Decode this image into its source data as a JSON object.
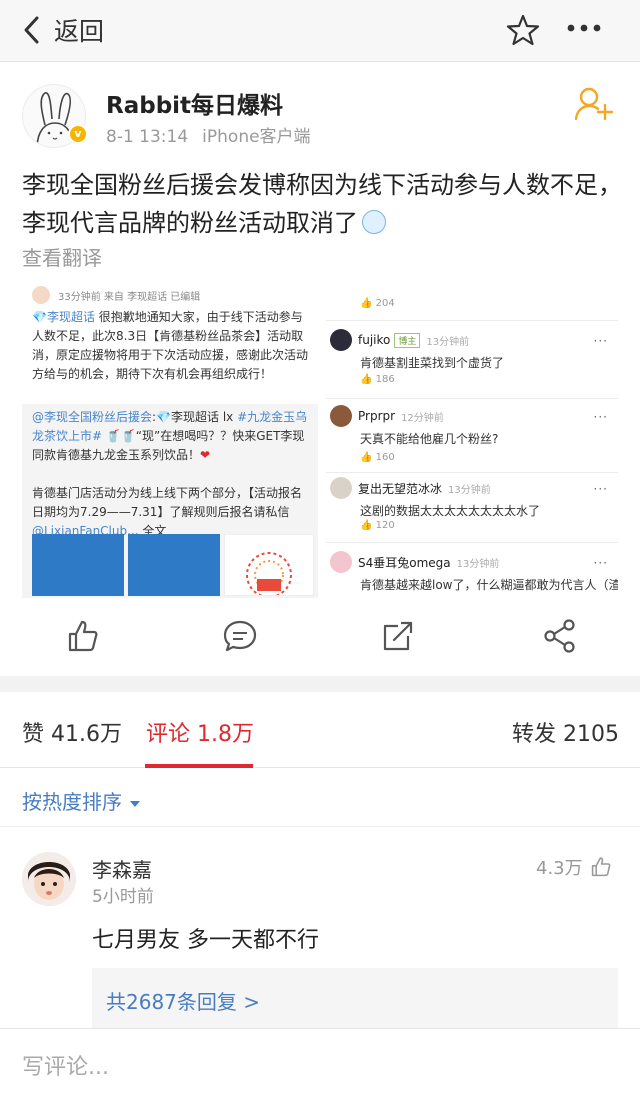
{
  "nav": {
    "back_label": "返回",
    "star_icon": "star-outline-icon",
    "more_icon": "more-dots-icon"
  },
  "author": {
    "name": "Rabbit每日爆料",
    "date": "8-1 13:14",
    "client": "iPhone客户端",
    "verified_icon": "verified-badge-icon",
    "follow_icon": "add-follow-icon"
  },
  "post": {
    "text": "李现全国粉丝后援会发博称因为线下活动参与人数不足，李现代言品牌的粉丝活动取消了",
    "translate_label": "查看翻译"
  },
  "embedded": {
    "left": {
      "meta": "33分钟前  来自 李现超话  已编辑",
      "tag": "💎李现超话",
      "body": "很抱歉地通知大家，由于线下活动参与人数不足，此次8.3日【肯德基粉丝品茶会】活动取消，原定应援物将用于下次活动应援，感谢此次活动方给与的机会，期待下次有机会再组织成行！",
      "quote_link": "@李现全国粉丝后援会",
      "quote_mid": ":💎李现超话 lx ",
      "quote_hashtag": "#九龙金玉乌龙茶饮上市#",
      "quote_rest": " 🥤🥤“现”在想喝吗？？快来GET李现同款肯德基九龙金玉系列饮品！",
      "quote_heart": "❤",
      "quote_body2": "肯德基门店活动分为线上线下两个部分，【活动报名日期均为7.29——7.31】了解规则后报名请私信",
      "quote_link2": "@LixianFanClub",
      "quote_more": "... 全文"
    },
    "right": {
      "top_like": "204",
      "comments": [
        {
          "name": "fujiko",
          "tag": "博主",
          "time": "13分钟前",
          "text": "肯德基割韭菜找到个虚货了",
          "likes": "186"
        },
        {
          "name": "Prprpr",
          "tag": "",
          "time": "12分钟前",
          "text": "天真不能给他雇几个粉丝?",
          "likes": "160"
        },
        {
          "name": "复出无望范冰冰",
          "tag": "",
          "time": "13分钟前",
          "text": "这剧的数据太太太太太太太太水了",
          "likes": "120"
        },
        {
          "name": "S4垂耳兔omega",
          "tag": "",
          "time": "13分钟前",
          "text": "肯德基越来越low了，什么糊逼都敢为代言人（渣",
          "likes": ""
        }
      ]
    }
  },
  "actions": {
    "like_icon": "thumbs-up-icon",
    "comment_icon": "comment-icon",
    "share_icon": "repost-icon",
    "more_share_icon": "share-icon"
  },
  "stats": {
    "likes_label": "赞",
    "likes": "41.6万",
    "comments_label": "评论",
    "comments": "1.8万",
    "reposts_label": "转发",
    "reposts": "2105"
  },
  "sort_label": "按热度排序",
  "comment": {
    "name": "李森嘉",
    "time": "5小时前",
    "likes": "4.3万",
    "text": "七月男友 多一天都不行",
    "replies": "共2687条回复 >"
  },
  "composer": {
    "placeholder": "写评论..."
  }
}
